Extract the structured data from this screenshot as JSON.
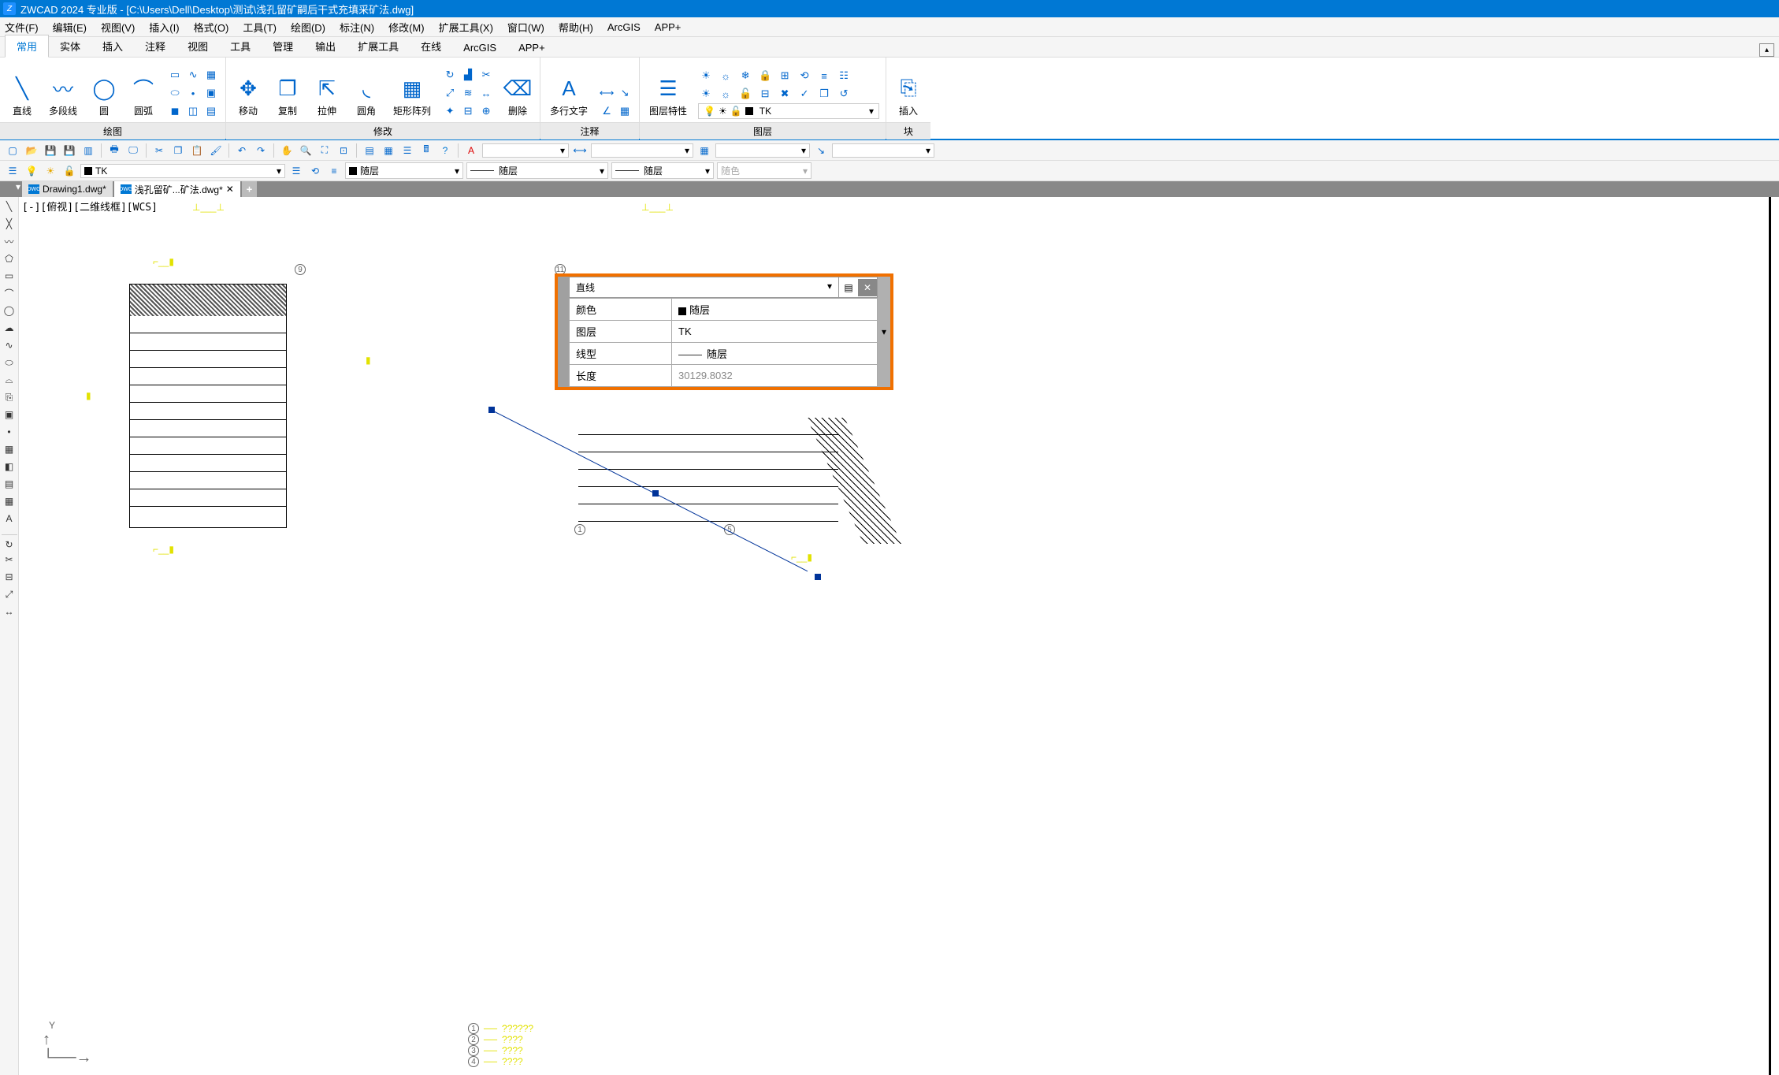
{
  "title_bar": {
    "app_name": "ZWCAD 2024 专业版",
    "doc_path": "[C:\\Users\\Dell\\Desktop\\测试\\浅孔留矿嗣后干式充填采矿法.dwg]"
  },
  "menu": {
    "file": "文件(F)",
    "edit": "编辑(E)",
    "view": "视图(V)",
    "insert": "插入(I)",
    "format": "格式(O)",
    "tools": "工具(T)",
    "draw": "绘图(D)",
    "dimension": "标注(N)",
    "modify": "修改(M)",
    "extend_tools": "扩展工具(X)",
    "window": "窗口(W)",
    "help": "帮助(H)",
    "arcgis": "ArcGIS",
    "app_plus": "APP+"
  },
  "ribbon_tabs": {
    "home": "常用",
    "solid": "实体",
    "insert": "插入",
    "annotate": "注释",
    "view": "视图",
    "tools": "工具",
    "manage": "管理",
    "output": "输出",
    "extend": "扩展工具",
    "online": "在线",
    "arcgis": "ArcGIS",
    "app_plus": "APP+"
  },
  "ribbon": {
    "draw_panel": {
      "line": "直线",
      "pline": "多段线",
      "circle": "圆",
      "arc": "圆弧",
      "title": "绘图"
    },
    "modify_panel": {
      "move": "移动",
      "copy": "复制",
      "stretch": "拉伸",
      "fillet": "圆角",
      "array": "矩形阵列",
      "erase": "删除",
      "title": "修改"
    },
    "annotate_panel": {
      "mtext": "多行文字",
      "title": "注释"
    },
    "layer_panel": {
      "props": "图层特性",
      "title": "图层",
      "current": "TK"
    },
    "block_panel": {
      "insert": "插入",
      "title": "块"
    }
  },
  "props_bar": {
    "layer": "TK",
    "color": "随层",
    "linetype": "随层",
    "lineweight": "随层",
    "color2": "随色"
  },
  "doc_tabs": {
    "t1": "Drawing1.dwg*",
    "t2": "浅孔留矿...矿法.dwg*"
  },
  "viewport_label": "[-][俯视][二维线框][WCS]",
  "properties_popup": {
    "object_type": "直线",
    "rows": {
      "color_label": "颜色",
      "color_value": "随层",
      "layer_label": "图层",
      "layer_value": "TK",
      "linetype_label": "线型",
      "linetype_value": "随层",
      "length_label": "长度",
      "length_value": "30129.8032"
    }
  },
  "legend": {
    "l1": "??????",
    "l2": "????",
    "l3": "????",
    "l4": "????"
  },
  "markers": {
    "m1": "1",
    "m5": "5",
    "m9": "9",
    "m11": "11"
  },
  "ucs": {
    "y": "Y"
  }
}
